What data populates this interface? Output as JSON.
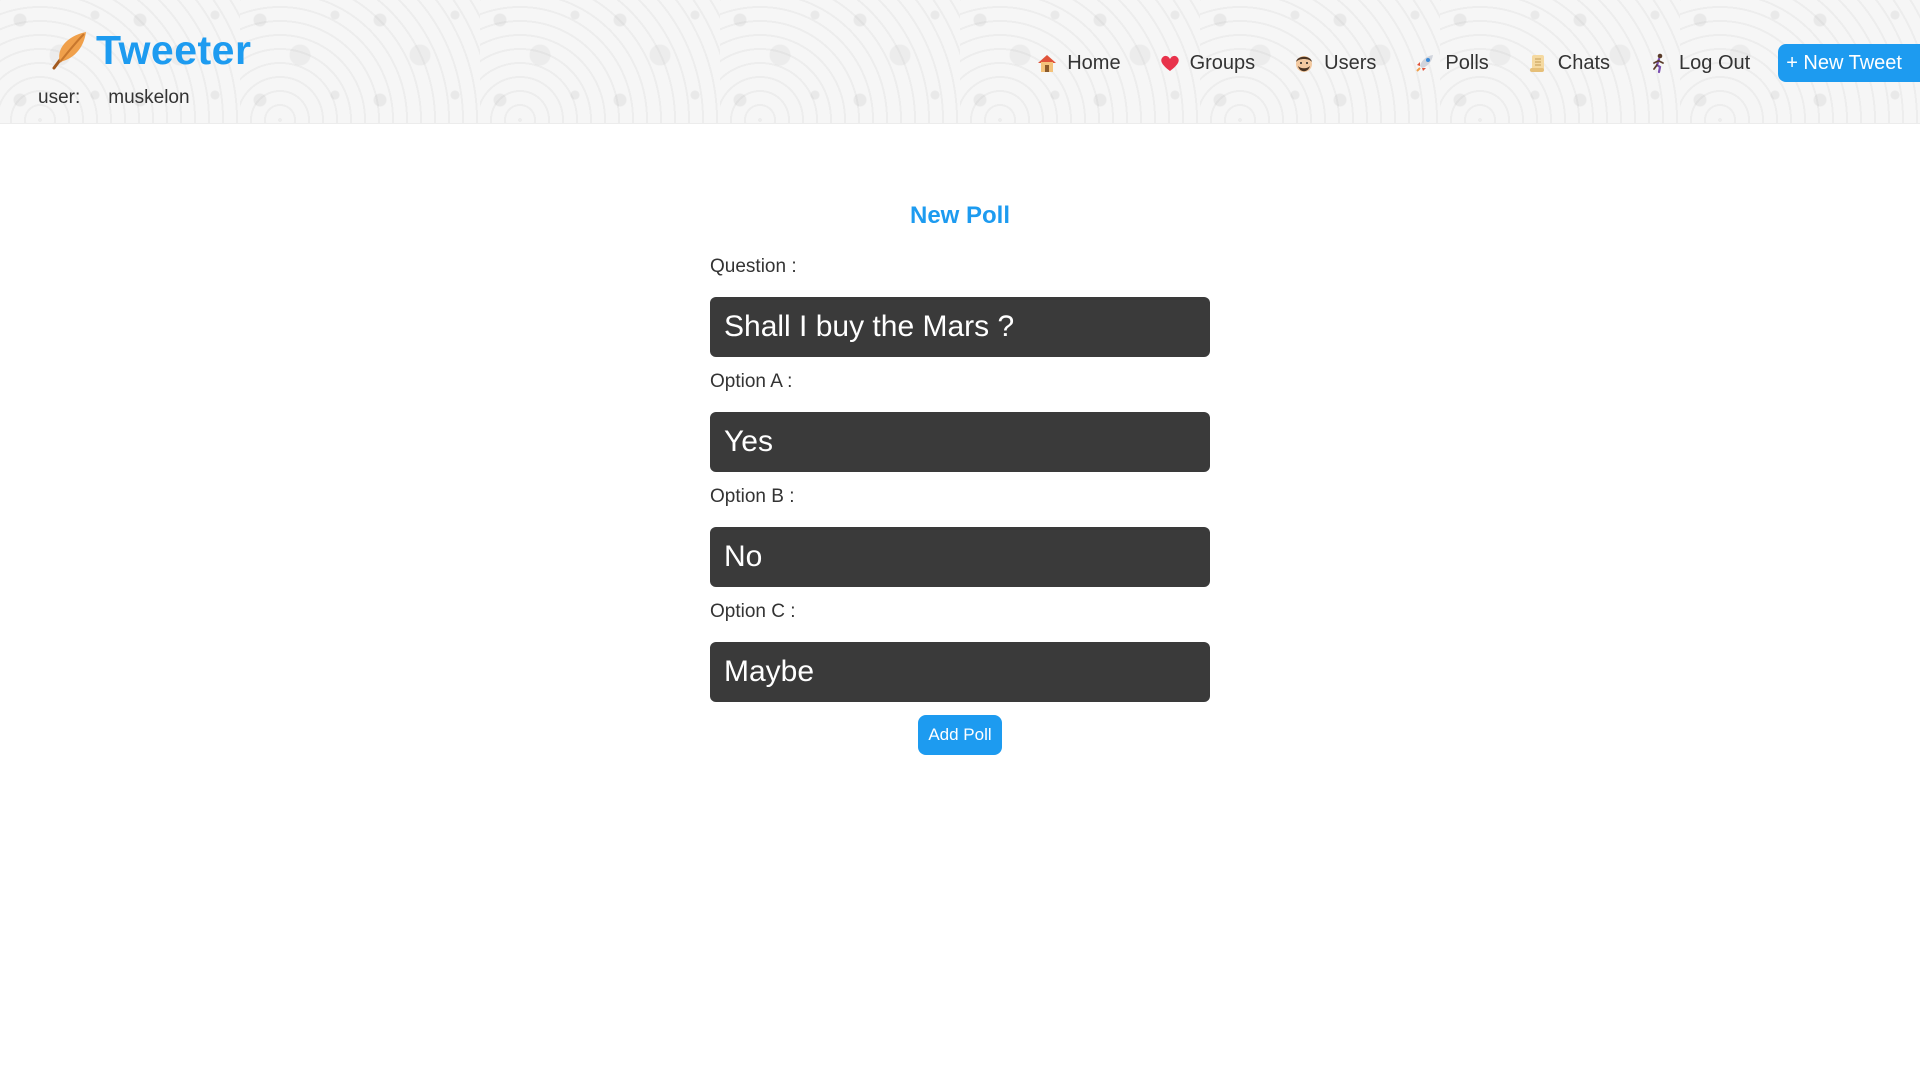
{
  "app": {
    "name": "Tweeter"
  },
  "user": {
    "label": "user:",
    "name": "muskelon"
  },
  "nav": {
    "items": [
      {
        "label": "Home",
        "icon": "house-icon"
      },
      {
        "label": "Groups",
        "icon": "heart-icon"
      },
      {
        "label": "Users",
        "icon": "face-icon"
      },
      {
        "label": "Polls",
        "icon": "rocket-icon"
      },
      {
        "label": "Chats",
        "icon": "scroll-icon"
      },
      {
        "label": "Log Out",
        "icon": "running-person-icon"
      }
    ],
    "new_tweet_label": "+ New Tweet"
  },
  "form": {
    "title": "New Poll",
    "question": {
      "label": "Question :",
      "value": "Shall I buy the Mars ?"
    },
    "option_a": {
      "label": "Option A :",
      "value": "Yes"
    },
    "option_b": {
      "label": "Option B :",
      "value": "No"
    },
    "option_c": {
      "label": "Option C :",
      "value": "Maybe"
    },
    "submit_label": "Add Poll"
  },
  "colors": {
    "accent": "#1d9bf0",
    "input_bg": "#3a3a3a",
    "header_bg": "#f6f6f6"
  }
}
